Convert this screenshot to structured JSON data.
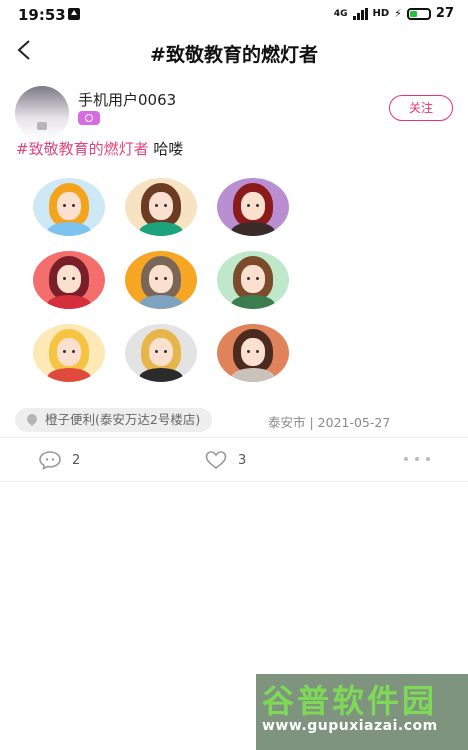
{
  "status_bar": {
    "time": "19:53",
    "network": "4G",
    "hd": "HD",
    "battery": "27"
  },
  "header": {
    "title": "#致敬教育的燃灯者"
  },
  "author": {
    "name": "手机用户0063",
    "follow_label": "关注"
  },
  "post": {
    "hashtag": "#致敬教育的燃灯者",
    "text": " 哈喽"
  },
  "images": [
    {
      "bg": "#cfe8f6",
      "hair": "#f4a31d",
      "cloth": "#7dc3ef"
    },
    {
      "bg": "#f7e3c1",
      "hair": "#6b3b22",
      "cloth": "#1aa37c"
    },
    {
      "bg": "#b98fd2",
      "hair": "#8b1a1a",
      "cloth": "#3a2a2a"
    },
    {
      "bg": "#f46e6b",
      "hair": "#7a1f2a",
      "cloth": "#d42f3a"
    },
    {
      "bg": "#f6a623",
      "hair": "#7a6656",
      "cloth": "#7fa2c0"
    },
    {
      "bg": "#bfe7c9",
      "hair": "#7b4b2a",
      "cloth": "#3b7d4e"
    },
    {
      "bg": "#fde9b6",
      "hair": "#f6c343",
      "cloth": "#e04a3c"
    },
    {
      "bg": "#e3e3e3",
      "hair": "#e6b64a",
      "cloth": "#2b2b2b"
    },
    {
      "bg": "#e0825a",
      "hair": "#4b2b20",
      "cloth": "#cbc3bb"
    }
  ],
  "location": {
    "place": "橙子便利(泰安万达2号楼店)",
    "meta": "泰安市 | 2021-05-27"
  },
  "actions": {
    "comments": "2",
    "likes": "3"
  },
  "watermark": {
    "title": "谷普软件园",
    "url": "www.gupuxiazai.com"
  }
}
